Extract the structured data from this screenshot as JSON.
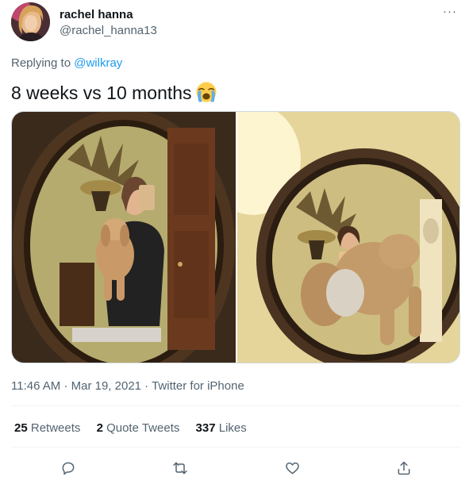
{
  "user": {
    "name": "rachel hanna",
    "handle": "@rachel_hanna13"
  },
  "more_label": "···",
  "reply": {
    "prefix": "Replying to",
    "mention": "@wilkray"
  },
  "tweet": {
    "text": "8 weeks vs 10 months",
    "emoji_icon": "loudly-crying-face-icon"
  },
  "media": {
    "photo_count": 2
  },
  "meta": {
    "time": "11:46 AM",
    "date": "Mar 19, 2021",
    "source": "Twitter for iPhone",
    "separator": "·"
  },
  "stats": {
    "retweets_count": "25",
    "retweets_label": "Retweets",
    "quotes_count": "2",
    "quotes_label": "Quote Tweets",
    "likes_count": "337",
    "likes_label": "Likes"
  },
  "actions": [
    {
      "icon": "reply-icon"
    },
    {
      "icon": "retweet-icon"
    },
    {
      "icon": "like-icon"
    },
    {
      "icon": "share-icon"
    }
  ],
  "colors": {
    "text_primary": "#0f1419",
    "text_secondary": "#536471",
    "link": "#1d9bf0",
    "divider": "#eff3f4"
  }
}
